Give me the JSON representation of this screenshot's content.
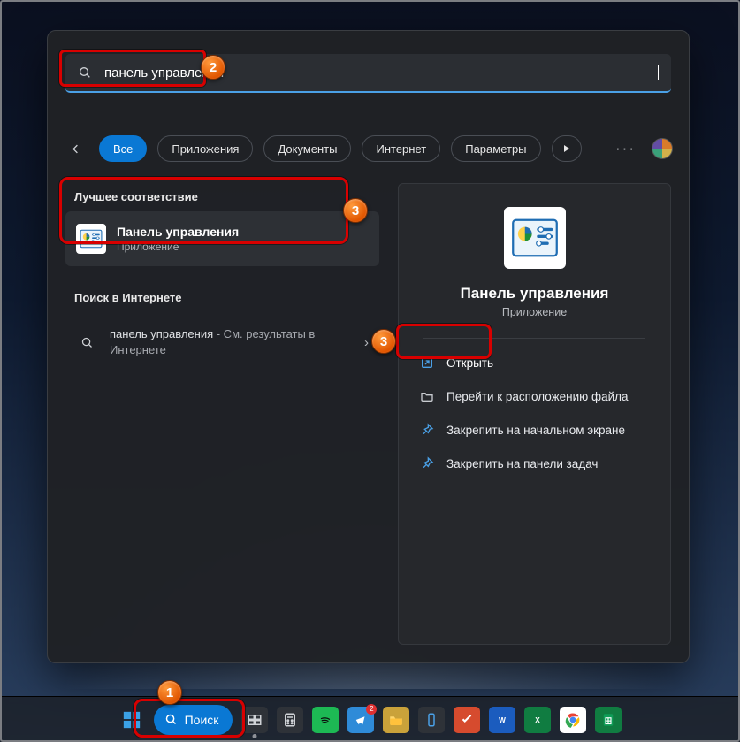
{
  "search": {
    "value": "панель управления"
  },
  "filters": {
    "all": "Все",
    "apps": "Приложения",
    "docs": "Документы",
    "web": "Интернет",
    "settings": "Параметры"
  },
  "left": {
    "bestHeader": "Лучшее соответствие",
    "bestTitle": "Панель управления",
    "bestSub": "Приложение",
    "webHeader": "Поиск в Интернете",
    "webQuery": "панель управления",
    "webSuffix": " - См. результаты в Интернете"
  },
  "preview": {
    "title": "Панель управления",
    "sub": "Приложение",
    "actions": {
      "open": "Открыть",
      "location": "Перейти к расположению файла",
      "pinStart": "Закрепить на начальном экране",
      "pinTaskbar": "Закрепить на панели задач"
    }
  },
  "taskbar": {
    "searchLabel": "Поиск"
  },
  "badges": {
    "n1": "1",
    "n2": "2",
    "n3": "3"
  }
}
